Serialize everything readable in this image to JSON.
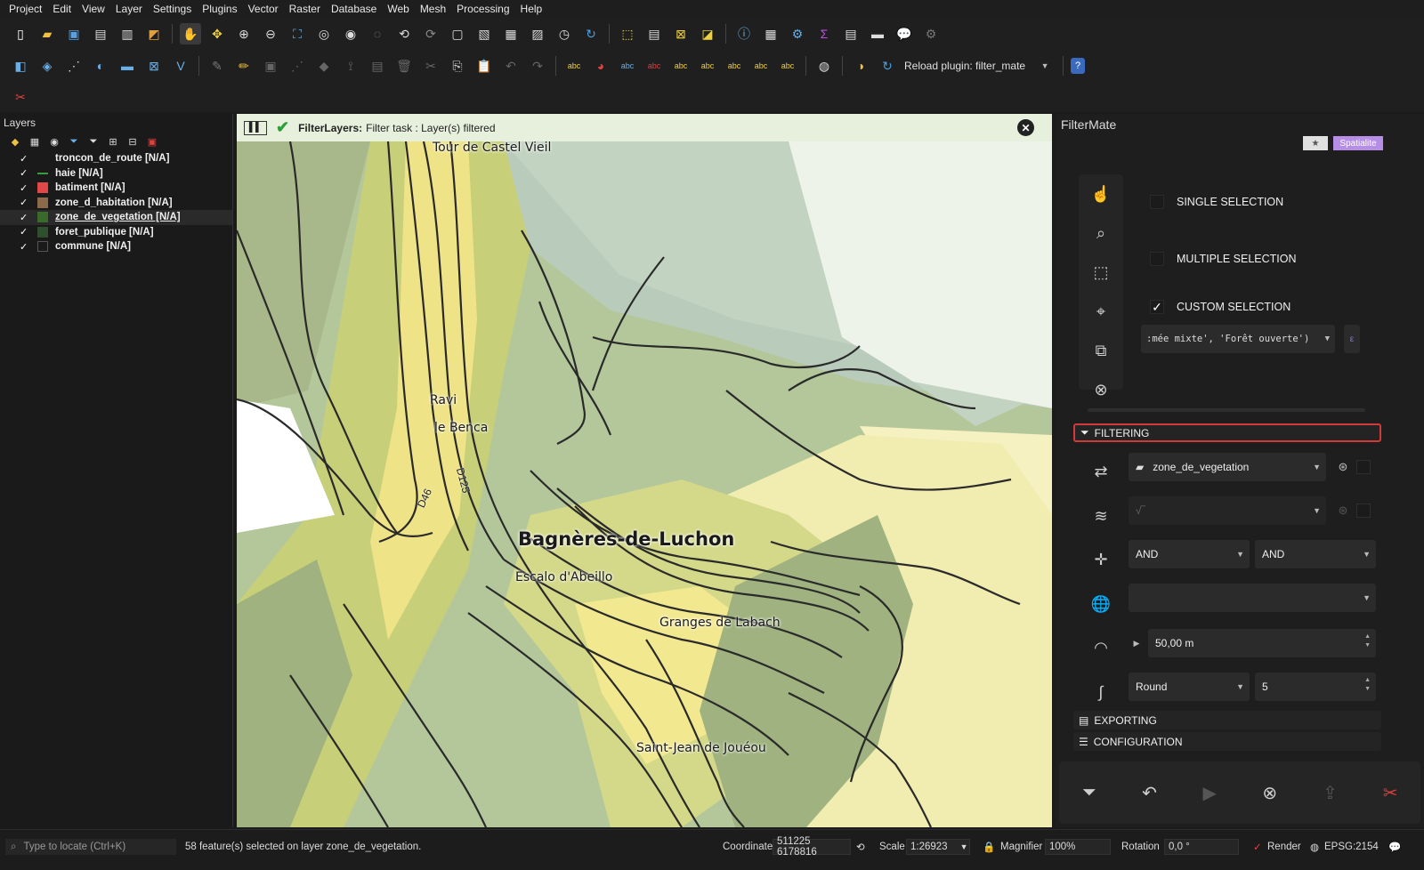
{
  "menu": [
    "Project",
    "Edit",
    "View",
    "Layer",
    "Settings",
    "Plugins",
    "Vector",
    "Raster",
    "Database",
    "Web",
    "Mesh",
    "Processing",
    "Help"
  ],
  "toolbar": {
    "reload_plugin_label": "Reload plugin: filter_mate"
  },
  "layers_panel": {
    "title": "Layers",
    "layers": [
      {
        "name": "troncon_de_route [N/A]",
        "checked": "✓",
        "color": "#1a1a1a"
      },
      {
        "name": "haie [N/A]",
        "checked": "✓",
        "color": "#3d9a3d"
      },
      {
        "name": "batiment [N/A]",
        "checked": "✓",
        "color": "#e04848"
      },
      {
        "name": "zone_d_habitation [N/A]",
        "checked": "✓",
        "color": "#8a6a4a"
      },
      {
        "name": "zone_de_vegetation [N/A]",
        "checked": "✓",
        "color": "#3a6a2a"
      },
      {
        "name": "foret_publique [N/A]",
        "checked": "✓",
        "color": "#2f4f2f"
      },
      {
        "name": "commune [N/A]",
        "checked": "✓",
        "color": "#1a1a1a"
      }
    ]
  },
  "message_bar": {
    "title": "FilterLayers:",
    "text": "Filter task : Layer(s) filtered"
  },
  "map": {
    "places": {
      "tour": "Tour de Castel Vieil",
      "ravi": "Ravi",
      "benca": "le Benca",
      "luchon": "Bagnères-de-Luchon",
      "escalo": "Escalo d'Abeillo",
      "granges": "Granges de Labach",
      "saint_jean": "Saint-Jean de Jouéou"
    },
    "roads": {
      "d46": "D46",
      "d125": "D125"
    }
  },
  "filtermate": {
    "title": "FilterMate",
    "star": "★",
    "badge": "Spatialite",
    "single_selection": "SINGLE SELECTION",
    "multiple_selection": "MULTIPLE SELECTION",
    "custom_selection": "CUSTOM SELECTION",
    "custom_checked": "✓",
    "expression": ":mée mixte', 'Forêt ouverte')",
    "filtering": "FILTERING",
    "source_layer": "zone_de_vegetation",
    "layers_to_filter": "",
    "combine_operator_1": "AND",
    "combine_operator_2": "AND",
    "predicates": "",
    "buffer_value": "50,00 m",
    "buffer_type": "Round",
    "segments": "5",
    "exporting": "EXPORTING",
    "configuration": "CONFIGURATION"
  },
  "statusbar": {
    "locate_placeholder": "Type to locate (Ctrl+K)",
    "message": "58 feature(s) selected on layer zone_de_vegetation.",
    "coordinate_label": "Coordinate",
    "coordinate_value": "511225 6178816",
    "scale_label": "Scale",
    "scale_value": "1:26923",
    "magnifier_label": "Magnifier",
    "magnifier_value": "100%",
    "rotation_label": "Rotation",
    "rotation_value": "0,0 °",
    "render_label": "Render",
    "crs": "EPSG:2154"
  }
}
